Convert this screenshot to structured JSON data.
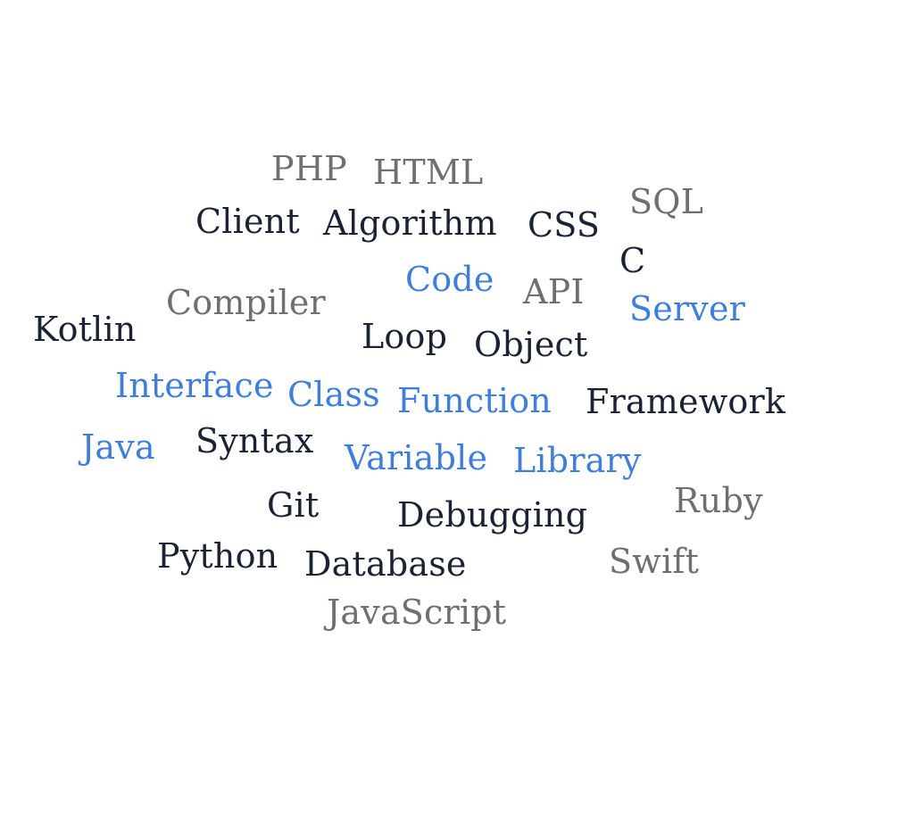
{
  "colors": {
    "dark": "#1b2233",
    "gray": "#6f6f6f",
    "blue": "#3f7fdb",
    "background": "#ffffff"
  },
  "words": {
    "php": "PHP",
    "html": "HTML",
    "sql": "SQL",
    "client": "Client",
    "algorithm": "Algorithm",
    "css": "CSS",
    "c": "C",
    "code": "Code",
    "api": "API",
    "compiler": "Compiler",
    "server": "Server",
    "kotlin": "Kotlin",
    "loop": "Loop",
    "object": "Object",
    "interface": "Interface",
    "class": "Class",
    "function": "Function",
    "framework": "Framework",
    "java": "Java",
    "syntax": "Syntax",
    "variable": "Variable",
    "library": "Library",
    "ruby": "Ruby",
    "git": "Git",
    "debugging": "Debugging",
    "python": "Python",
    "database": "Database",
    "swift": "Swift",
    "javascript": "JavaScript"
  }
}
